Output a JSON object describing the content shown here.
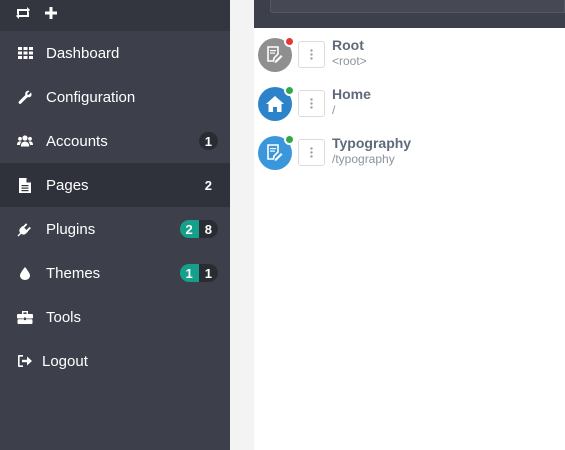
{
  "sidebar": {
    "top_icons": [
      {
        "name": "refresh-icon"
      },
      {
        "name": "plus-icon"
      }
    ],
    "items": [
      {
        "label": "Dashboard",
        "icon": "grid-icon",
        "badges": []
      },
      {
        "label": "Configuration",
        "icon": "wrench-icon",
        "badges": []
      },
      {
        "label": "Accounts",
        "icon": "users-icon",
        "badges": [
          "1"
        ]
      },
      {
        "label": "Pages",
        "icon": "file-icon",
        "badges": [
          "2"
        ],
        "active": true
      },
      {
        "label": "Plugins",
        "icon": "plug-icon",
        "badges": [
          "2",
          "8"
        ]
      },
      {
        "label": "Themes",
        "icon": "droplet-icon",
        "badges": [
          "1",
          "1"
        ]
      },
      {
        "label": "Tools",
        "icon": "briefcase-icon",
        "badges": []
      },
      {
        "label": "Logout",
        "icon": "sign-out-icon",
        "badges": []
      }
    ]
  },
  "pages": [
    {
      "title": "Root",
      "route": "<root>",
      "icon": "page-edit-icon",
      "status": "unpublished"
    },
    {
      "title": "Home",
      "route": "/",
      "icon": "home-icon",
      "status": "published"
    },
    {
      "title": "Typography",
      "route": "/typography",
      "icon": "page-edit-icon",
      "status": "published"
    }
  ],
  "colors": {
    "sidebar_bg": "#3d404b",
    "active_bg": "#30323b",
    "teal_badge": "#16a08b",
    "dark_badge": "#2a2c33",
    "status_red": "#e53935",
    "status_green": "#2eaa4a"
  }
}
